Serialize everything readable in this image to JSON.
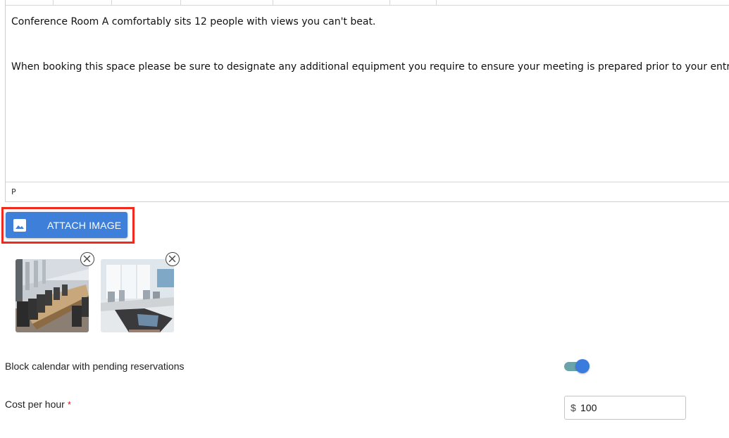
{
  "editor": {
    "paragraphs": [
      "Conference Room A comfortably sits 12 people with views you can't beat.",
      "When booking this space please be sure to designate any additional equipment you require to ensure your meeting is prepared prior to your entrance"
    ],
    "status_path": "P"
  },
  "attach": {
    "label": "ATTACH IMAGE",
    "icon": "image-icon"
  },
  "images": [
    {
      "name": "conference-table-photo",
      "remove_icon": "close-circle-icon"
    },
    {
      "name": "conference-phone-photo",
      "remove_icon": "close-circle-icon"
    }
  ],
  "settings": {
    "block_calendar": {
      "label": "Block calendar with pending reservations",
      "enabled": true
    },
    "cost_per_hour": {
      "label": "Cost per hour",
      "required_mark": "*",
      "currency": "$",
      "value": "100"
    }
  },
  "colors": {
    "accent": "#3d7fd9",
    "highlight": "#f02a1e",
    "required": "#d11a1a"
  }
}
